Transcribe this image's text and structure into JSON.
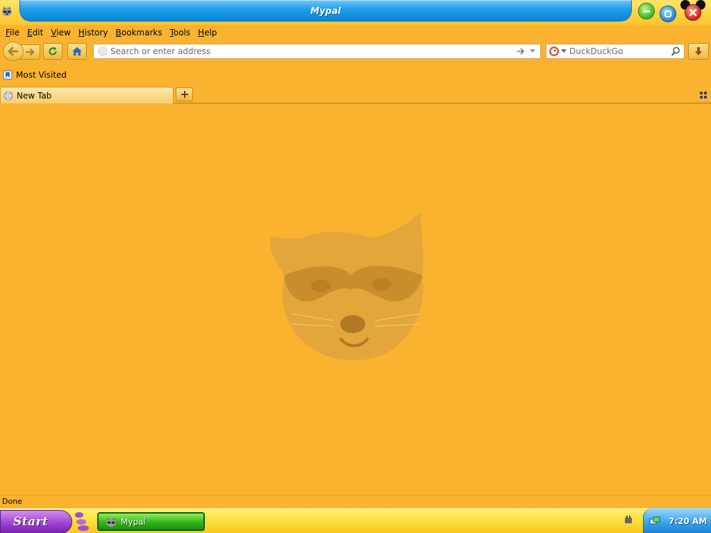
{
  "window": {
    "title": "Mypal",
    "buttons": {
      "minimize": "minimize-icon",
      "maximize": "maximize-icon",
      "close": "close-icon"
    }
  },
  "menu": {
    "items": [
      {
        "label": "File",
        "accesskey": "F",
        "rest": "ile"
      },
      {
        "label": "Edit",
        "accesskey": "E",
        "rest": "dit"
      },
      {
        "label": "View",
        "accesskey": "V",
        "rest": "iew"
      },
      {
        "label": "History",
        "accesskey": "H",
        "rest": "istory"
      },
      {
        "label": "Bookmarks",
        "accesskey": "B",
        "rest": "ookmarks"
      },
      {
        "label": "Tools",
        "accesskey": "T",
        "rest": "ools"
      },
      {
        "label": "Help",
        "accesskey": "H",
        "rest": "elp"
      }
    ]
  },
  "navbar": {
    "url_placeholder": "Search or enter address",
    "search_engine": "DuckDuckGo",
    "search_placeholder": "DuckDuckGo"
  },
  "bookmarks": {
    "items": [
      {
        "label": "Most Visited"
      }
    ]
  },
  "tabs": [
    {
      "label": "New Tab",
      "active": true
    }
  ],
  "status": {
    "text": "Done"
  },
  "taskbar": {
    "start_label": "Start",
    "tasks": [
      {
        "label": "Mypal"
      }
    ],
    "clock": "7:20 AM"
  },
  "colors": {
    "background": "#fbb32f",
    "titlebar_blue": "#1e9ee8",
    "start_purple": "#9a3fcf",
    "task_green": "#33b61a"
  }
}
